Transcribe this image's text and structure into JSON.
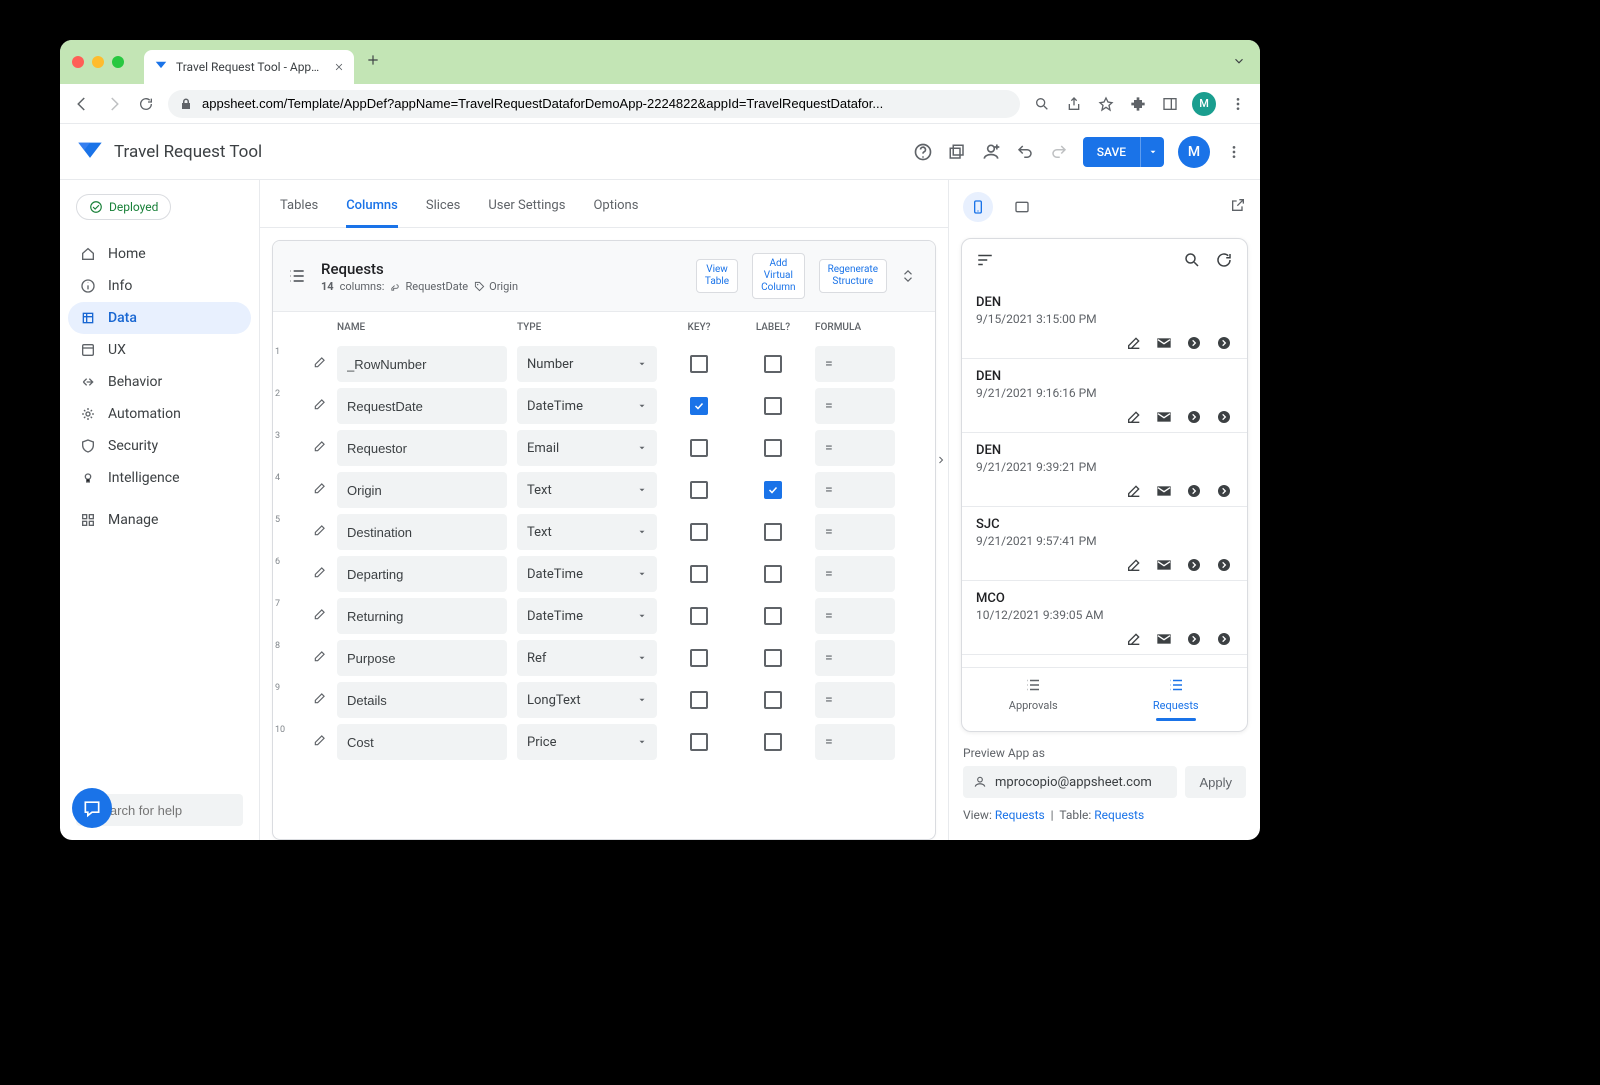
{
  "browser": {
    "tab_title": "Travel Request Tool - AppShee",
    "url": "appsheet.com/Template/AppDef?appName=TravelRequestDataforDemoApp-2224822&appId=TravelRequestDatafor...",
    "avatar_letter": "M"
  },
  "header": {
    "app_name": "Travel Request Tool",
    "save_label": "SAVE",
    "avatar_letter": "M"
  },
  "sidebar": {
    "deployed_label": "Deployed",
    "items": [
      {
        "label": "Home",
        "icon": "home"
      },
      {
        "label": "Info",
        "icon": "info"
      },
      {
        "label": "Data",
        "icon": "data",
        "active": true
      },
      {
        "label": "UX",
        "icon": "ux"
      },
      {
        "label": "Behavior",
        "icon": "behavior"
      },
      {
        "label": "Automation",
        "icon": "automation"
      },
      {
        "label": "Security",
        "icon": "security"
      },
      {
        "label": "Intelligence",
        "icon": "intelligence"
      },
      {
        "label": "Manage",
        "icon": "manage"
      }
    ],
    "search_placeholder": "Search for help"
  },
  "main_tabs": [
    "Tables",
    "Columns",
    "Slices",
    "User Settings",
    "Options"
  ],
  "main_tab_active": "Columns",
  "card": {
    "title": "Requests",
    "col_count": "14",
    "col_count_label": "columns:",
    "tag1": "RequestDate",
    "tag2": "Origin",
    "view_table": "View\nTable",
    "add_virtual": "Add\nVirtual\nColumn",
    "regen": "Regenerate\nStructure",
    "columns": {
      "name": "NAME",
      "type": "TYPE",
      "key": "KEY?",
      "label": "LABEL?",
      "formula": "FORMULA"
    },
    "rows": [
      {
        "n": 1,
        "name": "_RowNumber",
        "type": "Number",
        "key": false,
        "label": false,
        "formula": "="
      },
      {
        "n": 2,
        "name": "RequestDate",
        "type": "DateTime",
        "key": true,
        "label": false,
        "formula": "="
      },
      {
        "n": 3,
        "name": "Requestor",
        "type": "Email",
        "key": false,
        "label": false,
        "formula": "="
      },
      {
        "n": 4,
        "name": "Origin",
        "type": "Text",
        "key": false,
        "label": true,
        "formula": "="
      },
      {
        "n": 5,
        "name": "Destination",
        "type": "Text",
        "key": false,
        "label": false,
        "formula": "="
      },
      {
        "n": 6,
        "name": "Departing",
        "type": "DateTime",
        "key": false,
        "label": false,
        "formula": "="
      },
      {
        "n": 7,
        "name": "Returning",
        "type": "DateTime",
        "key": false,
        "label": false,
        "formula": "="
      },
      {
        "n": 8,
        "name": "Purpose",
        "type": "Ref",
        "key": false,
        "label": false,
        "formula": "="
      },
      {
        "n": 9,
        "name": "Details",
        "type": "LongText",
        "key": false,
        "label": false,
        "formula": "="
      },
      {
        "n": 10,
        "name": "Cost",
        "type": "Price",
        "key": false,
        "label": false,
        "formula": "="
      }
    ]
  },
  "preview": {
    "items": [
      {
        "t": "DEN",
        "s": "9/15/2021 3:15:00 PM"
      },
      {
        "t": "DEN",
        "s": "9/21/2021 9:16:16 PM"
      },
      {
        "t": "DEN",
        "s": "9/21/2021 9:39:21 PM"
      },
      {
        "t": "SJC",
        "s": "9/21/2021 9:57:41 PM"
      },
      {
        "t": "MCO",
        "s": "10/12/2021 9:39:05 AM"
      }
    ],
    "nav": [
      {
        "label": "Approvals"
      },
      {
        "label": "Requests",
        "active": true
      }
    ],
    "as_label": "Preview App as",
    "as_email": "mprocopio@appsheet.com",
    "apply": "Apply",
    "view_lbl": "View:",
    "view_val": "Requests",
    "table_lbl": "Table:",
    "table_val": "Requests"
  }
}
